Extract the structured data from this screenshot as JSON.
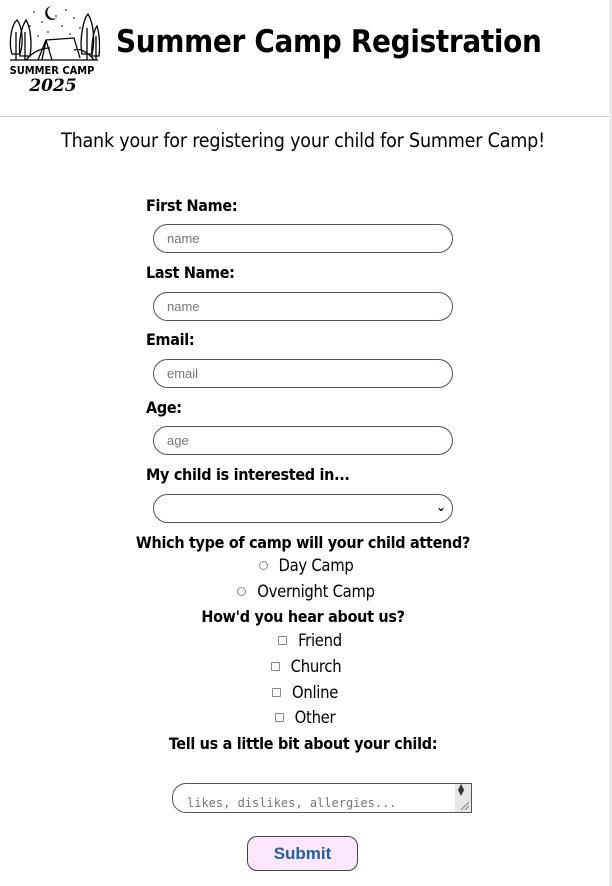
{
  "header": {
    "logo_text_line1": "SUMMER CAMP",
    "logo_text_line2": "2025",
    "title": "Summer Camp Registration"
  },
  "intro": "Thank your for registering your child for Summer Camp!",
  "form": {
    "first_name": {
      "label": "First Name:",
      "placeholder": "name",
      "value": ""
    },
    "last_name": {
      "label": "Last Name:",
      "placeholder": "name",
      "value": ""
    },
    "email": {
      "label": "Email:",
      "placeholder": "email",
      "value": ""
    },
    "age": {
      "label": "Age:",
      "placeholder": "age",
      "value": ""
    },
    "interest": {
      "label": "My child is interested in...",
      "selected": ""
    },
    "camp_type": {
      "label": "Which type of camp will your child attend?",
      "options": [
        "Day Camp",
        "Overnight Camp"
      ]
    },
    "referral": {
      "label": "How'd you hear about us?",
      "options": [
        "Friend",
        "Church",
        "Online",
        "Other"
      ]
    },
    "about": {
      "label": "Tell us a little bit about your child:",
      "placeholder": "likes, dislikes, allergies..."
    },
    "submit_label": "Submit"
  },
  "colors": {
    "submit_bg": "#fce6fb",
    "submit_text": "#1f5fa8"
  }
}
